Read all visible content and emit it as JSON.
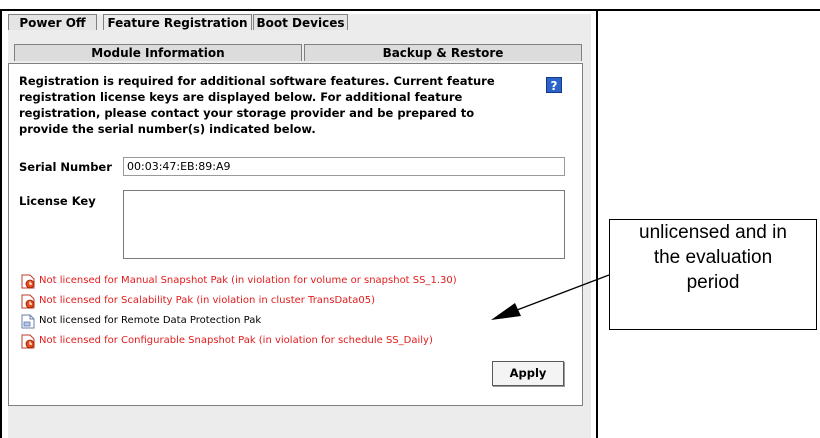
{
  "tabs_row1": [
    "Power Off",
    "Feature Registration",
    "Boot Devices"
  ],
  "tabs_row2": [
    "Module Information",
    "Backup & Restore"
  ],
  "active_tab": "Feature Registration",
  "description": "Registration is required for additional software features. Current feature registration license keys are displayed below. For additional feature registration, please contact your storage provider and be prepared to provide the serial number(s) indicated below.",
  "help_label": "?",
  "serial_label": "Serial Number",
  "serial_value": "00:03:47:EB:89:A9",
  "license_label": "License Key",
  "license_value": "",
  "licenses": [
    {
      "text": "Not licensed for Manual Snapshot Pak (in violation for volume or snapshot SS_1.30)",
      "status": "violation",
      "icon": "license-violation-icon"
    },
    {
      "text": "Not licensed for Scalability Pak (in violation in cluster TransData05)",
      "status": "violation",
      "icon": "license-violation-icon"
    },
    {
      "text": "Not licensed for Remote Data Protection Pak",
      "status": "unlicensed",
      "icon": "license-evaluation-icon"
    },
    {
      "text": "Not licensed for Configurable Snapshot Pak (in violation for schedule SS_Daily)",
      "status": "violation",
      "icon": "license-violation-icon"
    }
  ],
  "apply_label": "Apply",
  "callout_lines": [
    "unlicensed and in",
    "the evaluation",
    "period"
  ],
  "colors": {
    "violation": "#e21b1b",
    "accent": "#2b63c9"
  }
}
